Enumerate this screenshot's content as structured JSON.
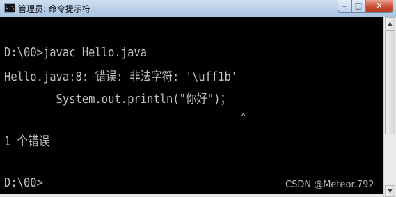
{
  "window": {
    "title": "管理员: 命令提示符",
    "icon_text": "C:\\",
    "icon": "console-icon",
    "controls": {
      "minimize": "–",
      "maximize": "□",
      "close": "✕"
    }
  },
  "console": {
    "lines": [
      "D:\\00>javac Hello.java",
      "Hello.java:8: 错误: 非法字符: '\\uff1b'",
      "        System.out.println(\"你好\")；",
      "",
      "1 个错误",
      "",
      "D:\\00>"
    ],
    "caret": "^"
  },
  "watermark": "CSDN @Meteor.792",
  "colors": {
    "console_bg": "#000000",
    "console_fg": "#c0c0c0",
    "titlebar": "#bdd2ea",
    "close_button": "#c94a2f"
  }
}
